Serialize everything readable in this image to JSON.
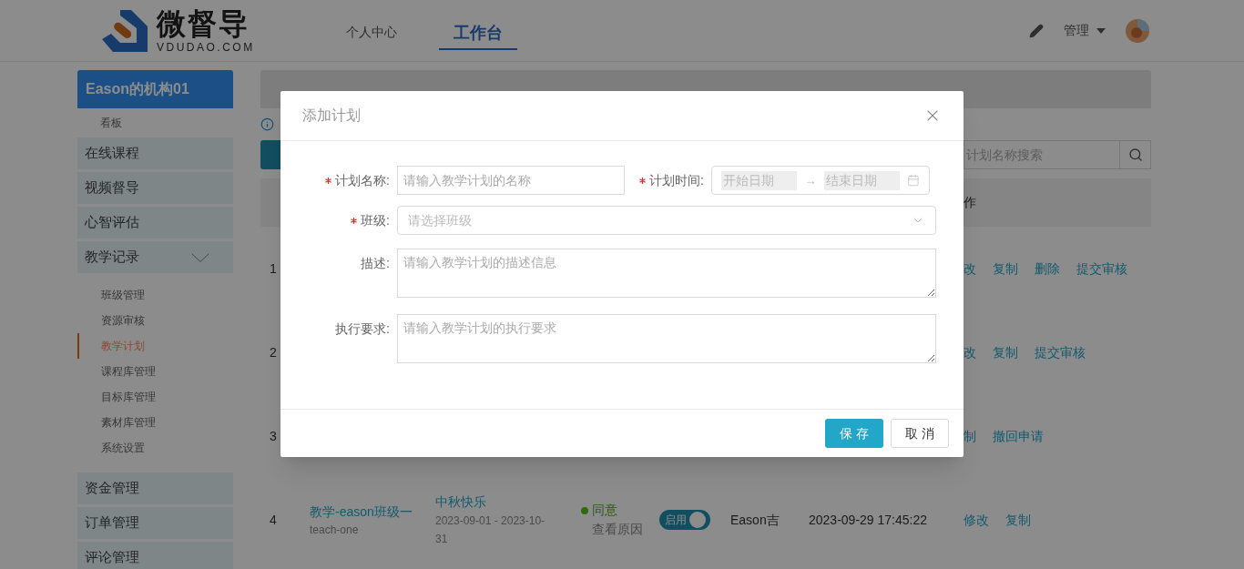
{
  "header": {
    "logo_name": "微督导",
    "logo_domain": "VDUDAO.COM",
    "nav": [
      {
        "label": "个人中心",
        "selected": false
      },
      {
        "label": "工作台",
        "selected": true
      }
    ],
    "user_menu": "管理"
  },
  "sidebar": {
    "org": "Eason的机构01",
    "items": [
      {
        "kind": "sub",
        "label": "看板",
        "selected": false
      },
      {
        "kind": "group",
        "label": "在线课程"
      },
      {
        "kind": "group",
        "label": "视频督导"
      },
      {
        "kind": "group",
        "label": "心智评估"
      },
      {
        "kind": "group",
        "label": "教学记录",
        "expanded": true,
        "children": [
          {
            "label": "班级管理",
            "selected": false
          },
          {
            "label": "资源审核",
            "selected": false
          },
          {
            "label": "教学计划",
            "selected": true
          },
          {
            "label": "课程库管理",
            "selected": false
          },
          {
            "label": "目标库管理",
            "selected": false
          },
          {
            "label": "素材库管理",
            "selected": false
          },
          {
            "label": "系统设置",
            "selected": false
          }
        ]
      },
      {
        "kind": "group",
        "label": "资金管理"
      },
      {
        "kind": "group",
        "label": "订单管理"
      },
      {
        "kind": "group",
        "label": "评论管理"
      }
    ]
  },
  "search": {
    "placeholder": "计划名称搜索"
  },
  "table": {
    "columns": [
      {
        "label": "作"
      }
    ],
    "rows": [
      {
        "index": "1",
        "actions": [
          "改",
          "复制",
          "删除",
          "提交审核"
        ]
      },
      {
        "index": "2",
        "actions": [
          "改",
          "复制",
          "提交审核"
        ]
      },
      {
        "index": "3",
        "actions": [
          "制",
          "撤回申请"
        ]
      },
      {
        "index": "4",
        "class_name": "教学-eason班级一",
        "class_code": "teach-one",
        "plan": "中秋快乐",
        "dates": "2023-09-01 - 2023-10-31",
        "status": {
          "label": "同意",
          "color": "#2d6c0e"
        },
        "reason": "查看原因",
        "toggle": {
          "label": "启用",
          "on": true
        },
        "creator": "Eason吉",
        "time": "2023-09-29 17:45:22",
        "actions": [
          "修改",
          "复制"
        ]
      }
    ]
  },
  "modal": {
    "title": "添加计划",
    "rows": [
      [
        {
          "kind": "text",
          "label": "计划名称:",
          "required": true,
          "placeholder": "请输入教学计划的名称"
        },
        {
          "kind": "daterange",
          "label": "计划时间:",
          "required": true,
          "start_placeholder": "开始日期",
          "separator": "→",
          "end_placeholder": "结束日期"
        }
      ],
      [
        {
          "kind": "select",
          "label": "班级:",
          "required": true,
          "placeholder": "请选择班级"
        }
      ],
      [
        {
          "kind": "textarea",
          "label": "描述:",
          "required": false,
          "placeholder": "请输入教学计划的描述信息"
        }
      ],
      [
        {
          "kind": "textarea",
          "label": "执行要求:",
          "required": false,
          "placeholder": "请输入教学计划的执行要求"
        }
      ]
    ],
    "buttons": [
      {
        "kind": "primary",
        "label": "保存"
      },
      {
        "kind": "default",
        "label": "取消"
      }
    ]
  }
}
